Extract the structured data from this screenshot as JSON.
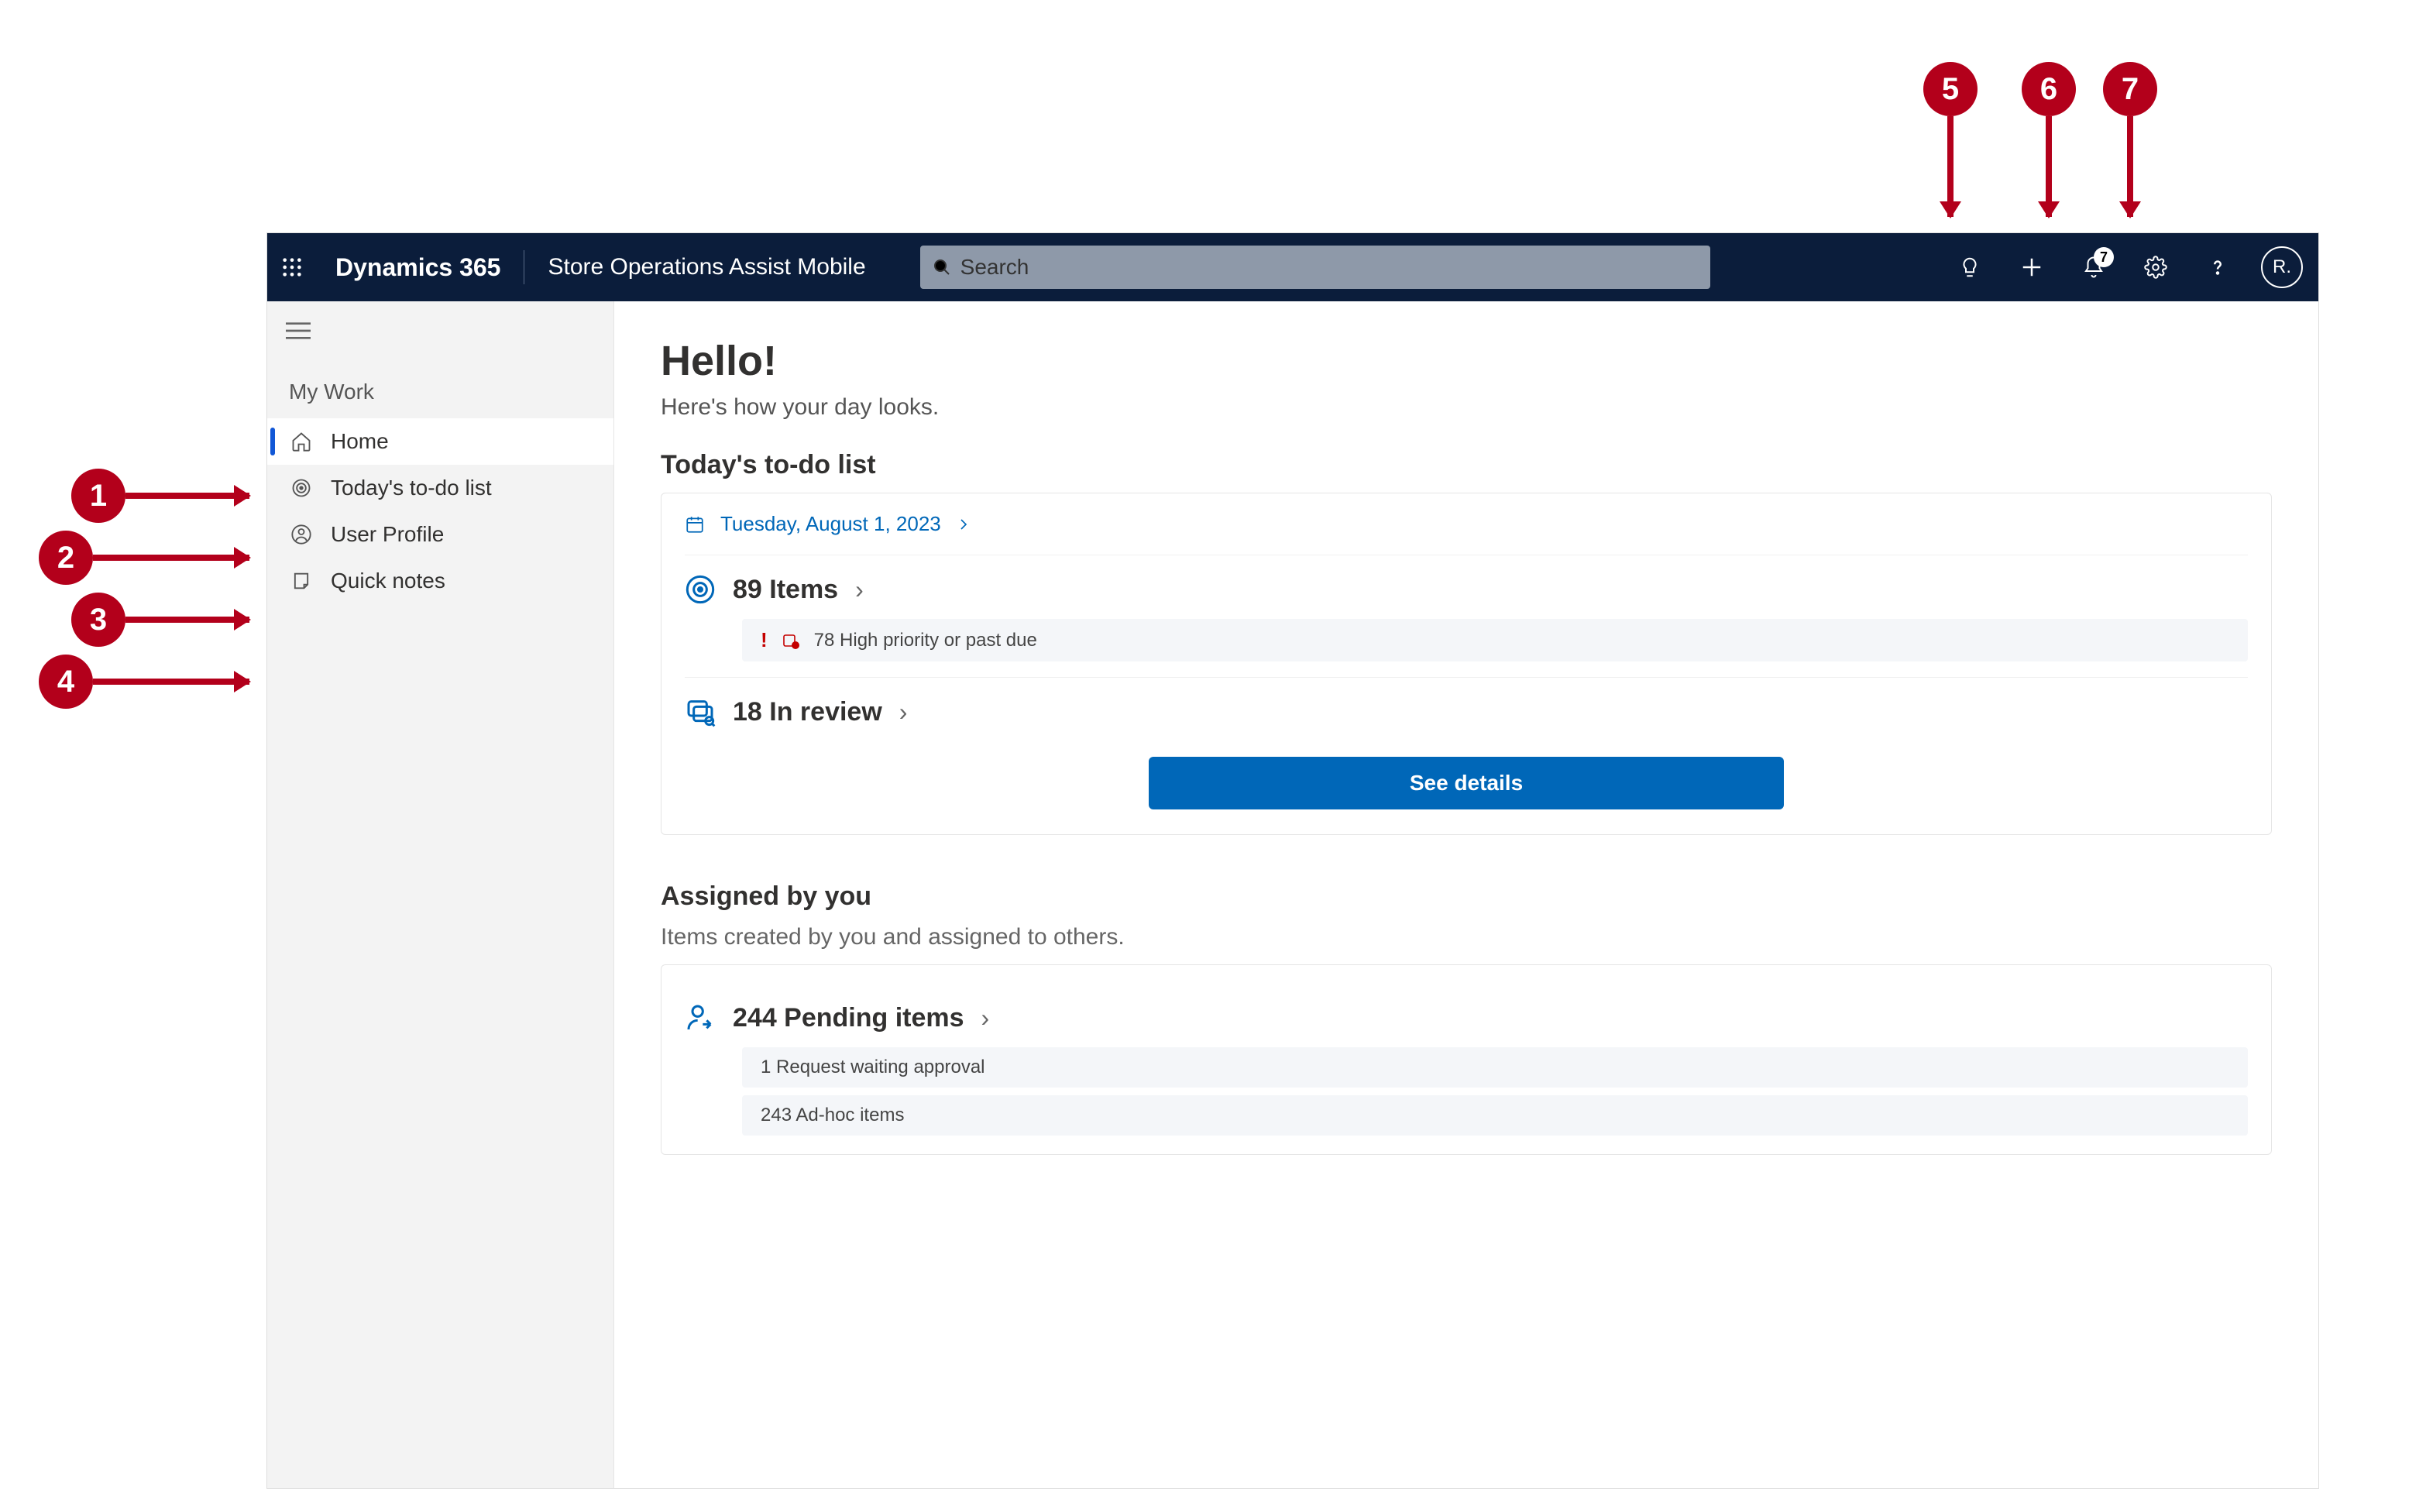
{
  "annotations": {
    "left": [
      "1",
      "2",
      "3",
      "4"
    ],
    "top": [
      "5",
      "6",
      "7"
    ]
  },
  "topbar": {
    "brand": "Dynamics 365",
    "app_name": "Store Operations Assist Mobile",
    "search_placeholder": "Search",
    "notification_count": "7",
    "avatar_initials": "R."
  },
  "sidebar": {
    "group_label": "My Work",
    "items": [
      {
        "label": "Home",
        "icon": "home-icon",
        "active": true
      },
      {
        "label": "Today's to-do list",
        "icon": "target-icon"
      },
      {
        "label": "User Profile",
        "icon": "user-icon"
      },
      {
        "label": "Quick notes",
        "icon": "note-icon"
      }
    ]
  },
  "main": {
    "greeting": "Hello!",
    "subgreeting": "Here's how your day looks.",
    "todo": {
      "title": "Today's to-do list",
      "date_label": "Tuesday, August 1, 2023",
      "items_count_label": "89 Items",
      "high_priority_label": "78 High priority or past due",
      "in_review_label": "18 In review",
      "cta": "See details"
    },
    "assigned": {
      "title": "Assigned by you",
      "subtitle": "Items created by you and assigned to others.",
      "pending_label": "244 Pending items",
      "sub1": "1 Request waiting approval",
      "sub2": "243 Ad-hoc items"
    }
  }
}
